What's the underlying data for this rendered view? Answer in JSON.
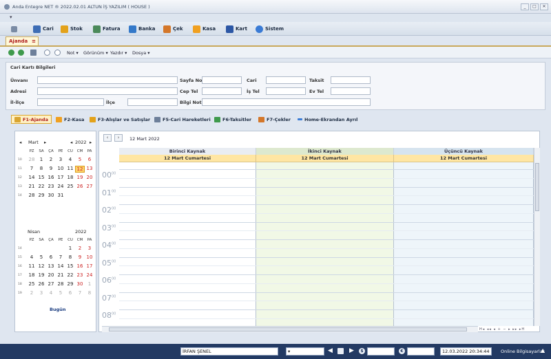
{
  "window": {
    "title": "Anda Entegre NET ® 2022.02.01 ALTUN İŞ YAZILIM ( HOUSE )",
    "btns": [
      "_",
      "□",
      "✕"
    ]
  },
  "menu": [
    {
      "label": "Cari",
      "color": "#3d6db5"
    },
    {
      "label": "Stok",
      "color": "#e3a21a"
    },
    {
      "label": "Fatura",
      "color": "#4b8a5a"
    },
    {
      "label": "Banka",
      "color": "#3479c9"
    },
    {
      "label": "Çek",
      "color": "#d4772a"
    },
    {
      "label": "Kasa",
      "color": "#f0a020"
    },
    {
      "label": "Kart",
      "color": "#2c57a5"
    },
    {
      "label": "Sistem",
      "color": "#3a7bd5"
    }
  ],
  "doc_tab": {
    "label": "Ajanda",
    "close": "≡"
  },
  "toolbar": {
    "not": "Not ▾",
    "gorunum": "Görünüm ▾",
    "yazdir": "Yazdır ▾",
    "dosya": "Dosya ▾"
  },
  "form": {
    "header": "Cari Kartı Bilgileri",
    "labels": {
      "unvani": "Ünvanı",
      "sayfa_no": "Sayfa No",
      "cari": "Cari",
      "taksit": "Taksit",
      "adresi": "Adresi",
      "cep_tel": "Cep Tel",
      "is_tel": "İş Tel",
      "ev_tel": "Ev Tel",
      "il_ilce": "İl-İlçe",
      "ilce": "İlçe",
      "bilgi_notu": "Bilgi Notu"
    }
  },
  "function_tabs": [
    {
      "label": "F1-Ajanda",
      "color": "#d9a531"
    },
    {
      "label": "F2-Kasa",
      "color": "#f0a020"
    },
    {
      "label": "F3-Alışlar ve Satışlar",
      "color": "#e3a21a"
    },
    {
      "label": "F5-Cari Hareketleri",
      "color": "#6d7f9a"
    },
    {
      "label": "F6-Taksitler",
      "color": "#3f9a4c"
    },
    {
      "label": "F7-Çekler",
      "color": "#d4772a"
    },
    {
      "label": "Home-Ekrandan Ayrıl",
      "color": "#3a7bd5"
    }
  ],
  "calendar": {
    "month1": {
      "name": "Mart",
      "year": "2022",
      "prev": "◂",
      "next": "▸"
    },
    "month2": {
      "name": "Nisan",
      "year": "2022"
    },
    "weekdays": [
      "PZ",
      "SA",
      "ÇA",
      "PE",
      "CU",
      "CM",
      "PA"
    ],
    "weeks1": [
      {
        "wk": "10",
        "days": [
          "28",
          "1",
          "2",
          "3",
          "4",
          "5",
          "6"
        ]
      },
      {
        "wk": "11",
        "days": [
          "7",
          "8",
          "9",
          "10",
          "11",
          "12",
          "13"
        ]
      },
      {
        "wk": "12",
        "days": [
          "14",
          "15",
          "16",
          "17",
          "18",
          "19",
          "20"
        ]
      },
      {
        "wk": "13",
        "days": [
          "21",
          "22",
          "23",
          "24",
          "25",
          "26",
          "27"
        ]
      },
      {
        "wk": "14",
        "days": [
          "28",
          "29",
          "30",
          "31",
          "",
          "",
          ""
        ]
      }
    ],
    "weeks2": [
      {
        "wk": "14",
        "days": [
          "",
          "",
          "",
          "",
          "1",
          "2",
          "3"
        ]
      },
      {
        "wk": "15",
        "days": [
          "4",
          "5",
          "6",
          "7",
          "8",
          "9",
          "10"
        ]
      },
      {
        "wk": "16",
        "days": [
          "11",
          "12",
          "13",
          "14",
          "15",
          "16",
          "17"
        ]
      },
      {
        "wk": "17",
        "days": [
          "18",
          "19",
          "20",
          "21",
          "22",
          "23",
          "24"
        ]
      },
      {
        "wk": "18",
        "days": [
          "25",
          "26",
          "27",
          "28",
          "29",
          "30",
          "1"
        ]
      },
      {
        "wk": "19",
        "days": [
          "2",
          "3",
          "4",
          "5",
          "6",
          "7",
          "8"
        ]
      }
    ],
    "today": "12",
    "bugun": "Bugün"
  },
  "schedule": {
    "date": "12 Mart 2022",
    "nav_prev": "‹",
    "nav_next": "›",
    "columns": [
      {
        "name": "Birinci Kaynak",
        "day": "12 Mart Cumartesi",
        "bg": "#ffffff",
        "headbg": "#e9edf3"
      },
      {
        "name": "İkinci Kaynak",
        "day": "12 Mart Cumartesi",
        "bg": "#f1f8e6",
        "headbg": "#dde9cf"
      },
      {
        "name": "Üçüncü Kaynak",
        "day": "12 Mart Cumartesi",
        "bg": "#eef5fa",
        "headbg": "#d6e4ef"
      }
    ],
    "hours": [
      "00",
      "01",
      "02",
      "03",
      "04",
      "05",
      "06",
      "07",
      "08"
    ],
    "minutes": "00",
    "pager": "H◂ ◂◂ ◂ + − ▸ ▸▸ ▸H"
  },
  "status": {
    "user": "İRFAN ŞENEL",
    "select": "▾",
    "datetime": "12.03.2022  20:34:44",
    "online": "Online Bilgisayarlar"
  }
}
